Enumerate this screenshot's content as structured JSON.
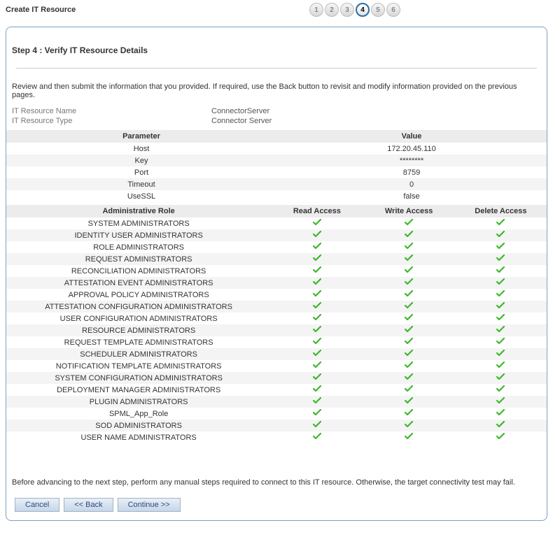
{
  "header": {
    "title": "Create IT Resource",
    "steps": [
      "1",
      "2",
      "3",
      "4",
      "5",
      "6"
    ],
    "currentStep": 4
  },
  "step": {
    "heading": "Step 4 : Verify IT Resource Details",
    "reviewText": "Review and then submit the information that you provided. If required, use the Back button to revisit and modify information provided on the previous pages."
  },
  "resource": {
    "nameLabel": "IT Resource Name",
    "nameValue": "ConnectorServer",
    "typeLabel": "IT Resource Type",
    "typeValue": "Connector Server"
  },
  "paramsTable": {
    "headers": {
      "param": "Parameter",
      "value": "Value"
    },
    "rows": [
      {
        "param": "Host",
        "value": "172.20.45.110"
      },
      {
        "param": "Key",
        "value": "********"
      },
      {
        "param": "Port",
        "value": "8759"
      },
      {
        "param": "Timeout",
        "value": "0"
      },
      {
        "param": "UseSSL",
        "value": "false"
      }
    ]
  },
  "rolesTable": {
    "headers": {
      "role": "Administrative Role",
      "read": "Read Access",
      "write": "Write Access",
      "del": "Delete Access"
    },
    "rows": [
      {
        "role": "SYSTEM ADMINISTRATORS",
        "read": true,
        "write": true,
        "del": true
      },
      {
        "role": "IDENTITY USER ADMINISTRATORS",
        "read": true,
        "write": true,
        "del": true
      },
      {
        "role": "ROLE ADMINISTRATORS",
        "read": true,
        "write": true,
        "del": true
      },
      {
        "role": "REQUEST ADMINISTRATORS",
        "read": true,
        "write": true,
        "del": true
      },
      {
        "role": "RECONCILIATION ADMINISTRATORS",
        "read": true,
        "write": true,
        "del": true
      },
      {
        "role": "ATTESTATION EVENT ADMINISTRATORS",
        "read": true,
        "write": true,
        "del": true
      },
      {
        "role": "APPROVAL POLICY ADMINISTRATORS",
        "read": true,
        "write": true,
        "del": true
      },
      {
        "role": "ATTESTATION CONFIGURATION ADMINISTRATORS",
        "read": true,
        "write": true,
        "del": true
      },
      {
        "role": "USER CONFIGURATION ADMINISTRATORS",
        "read": true,
        "write": true,
        "del": true
      },
      {
        "role": "RESOURCE ADMINISTRATORS",
        "read": true,
        "write": true,
        "del": true
      },
      {
        "role": "REQUEST TEMPLATE ADMINISTRATORS",
        "read": true,
        "write": true,
        "del": true
      },
      {
        "role": "SCHEDULER ADMINISTRATORS",
        "read": true,
        "write": true,
        "del": true
      },
      {
        "role": "NOTIFICATION TEMPLATE ADMINISTRATORS",
        "read": true,
        "write": true,
        "del": true
      },
      {
        "role": "SYSTEM CONFIGURATION ADMINISTRATORS",
        "read": true,
        "write": true,
        "del": true
      },
      {
        "role": "DEPLOYMENT MANAGER ADMINISTRATORS",
        "read": true,
        "write": true,
        "del": true
      },
      {
        "role": "PLUGIN ADMINISTRATORS",
        "read": true,
        "write": true,
        "del": true
      },
      {
        "role": "SPML_App_Role",
        "read": true,
        "write": true,
        "del": true
      },
      {
        "role": "SOD ADMINISTRATORS",
        "read": true,
        "write": true,
        "del": true
      },
      {
        "role": "USER NAME ADMINISTRATORS",
        "read": true,
        "write": true,
        "del": true
      }
    ]
  },
  "footerText": "Before advancing to the next step, perform any manual steps required to connect to this IT resource. Otherwise, the target connectivity test may fail.",
  "buttons": {
    "cancel": "Cancel",
    "back": "<< Back",
    "cont": "Continue >>"
  }
}
